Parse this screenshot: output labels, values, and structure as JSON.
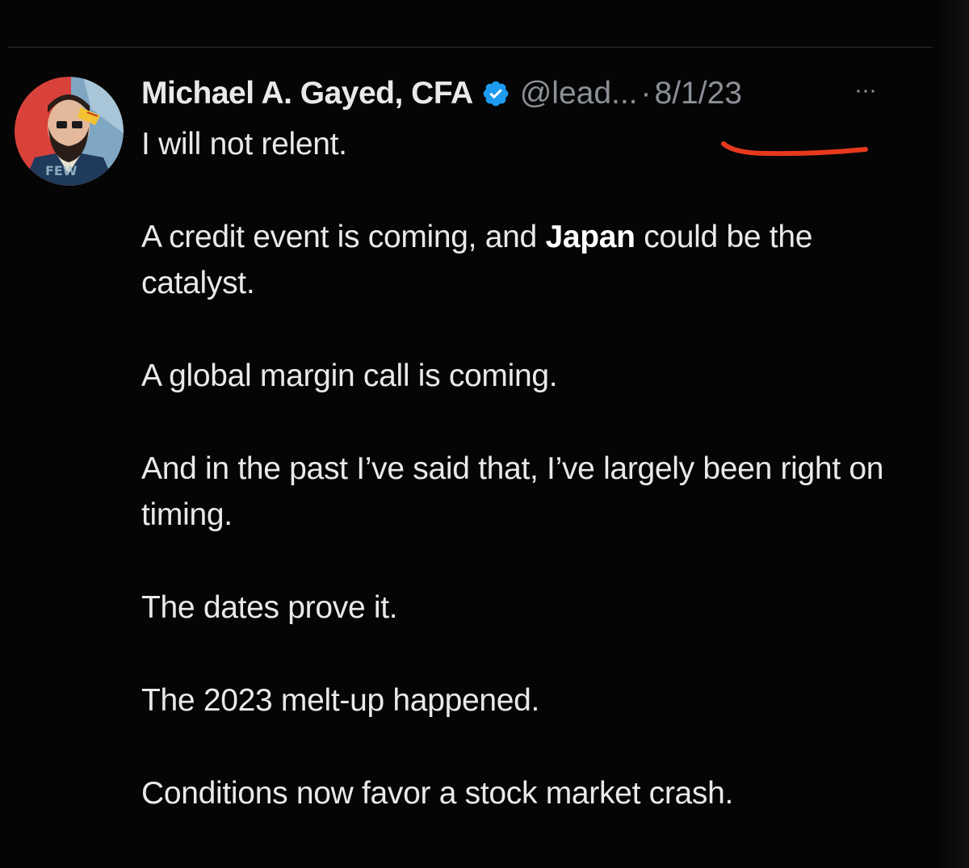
{
  "tweet": {
    "author_name": "Michael A. Gayed, CFA",
    "handle": "@lead...",
    "separator": "·",
    "date": "8/1/23",
    "more_label": "···",
    "paragraphs": [
      [
        "I will not relent."
      ],
      [
        "A credit event is coming, and ",
        "Japan",
        " could be the catalyst."
      ],
      [
        "A global margin call is coming."
      ],
      [
        "And in the past I’ve said that, I’ve largely been right on timing."
      ],
      [
        "The dates prove it."
      ],
      [
        "The 2023 melt-up happened."
      ],
      [
        "Conditions now favor a stock market crash."
      ]
    ]
  },
  "icons": {
    "verified": "verified-badge-icon",
    "more": "more-options-icon",
    "avatar": "profile-avatar"
  },
  "colors": {
    "background": "#050505",
    "text": "#e7e9ea",
    "muted": "#8b9096",
    "verified": "#1d9bf0",
    "annotation": "#e8391d"
  }
}
